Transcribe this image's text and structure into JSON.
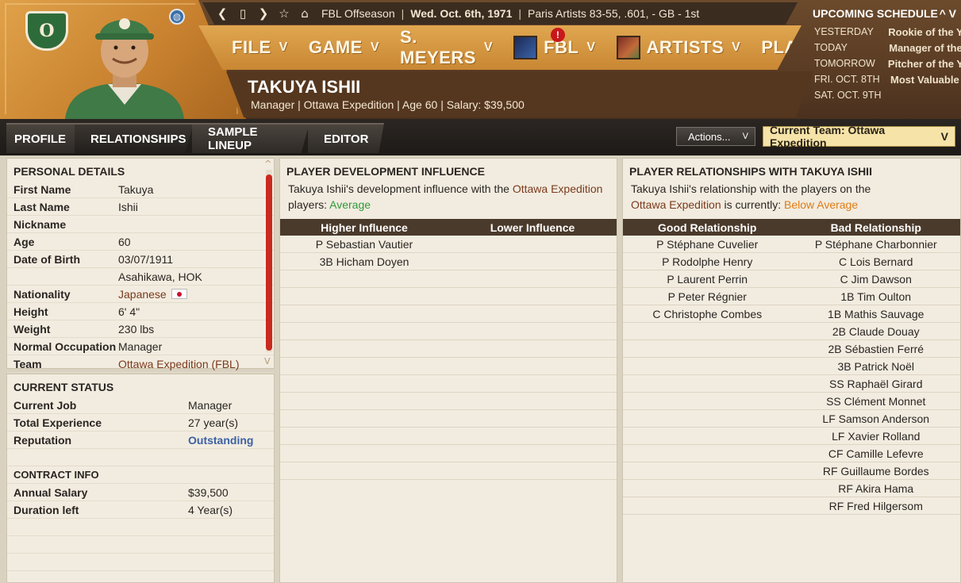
{
  "topbar": {
    "back_icon": "chevron-left-icon",
    "page_icon": "page-icon",
    "forward_icon": "chevron-right-icon",
    "star_icon": "star-icon",
    "home_icon": "home-icon",
    "stage": "FBL Offseason",
    "date": "Wed. Oct. 6th, 1971",
    "team_record": "Paris Artists  83-55, .601, - GB - 1st"
  },
  "menu": {
    "file": "FILE",
    "game": "GAME",
    "manager": "S. MEYERS",
    "league": "FBL",
    "league_alert": "!",
    "team": "ARTISTS",
    "play": "PLAY",
    "chevron": "V"
  },
  "person": {
    "name": "TAKUYA ISHII",
    "subtitle": "Manager | Ottawa Expedition  |  Age 60  |  Salary: $39,500",
    "team_logo_letter": "O"
  },
  "schedule": {
    "title": "UPCOMING SCHEDULE",
    "arrows": "^ V",
    "rows": [
      {
        "day": "YESTERDAY",
        "event": "Rookie of the Y"
      },
      {
        "day": "TODAY",
        "event": "Manager of the"
      },
      {
        "day": "TOMORROW",
        "event": "Pitcher of the Y"
      },
      {
        "day": "FRI. OCT. 8TH",
        "event": "Most Valuable"
      },
      {
        "day": "SAT. OCT. 9TH",
        "event": ""
      }
    ]
  },
  "tabs": {
    "profile": "PROFILE",
    "relationships": "RELATIONSHIPS",
    "sample_lineup": "SAMPLE LINEUP",
    "editor": "EDITOR"
  },
  "actions": {
    "label": "Actions...",
    "chevron": "V"
  },
  "team_select": {
    "label": "Current Team: Ottawa Expedition",
    "chevron": "V"
  },
  "personal": {
    "title": "PERSONAL DETAILS",
    "first_name_label": "First Name",
    "first_name": "Takuya",
    "last_name_label": "Last Name",
    "last_name": "Ishii",
    "nickname_label": "Nickname",
    "nickname": "",
    "age_label": "Age",
    "age": "60",
    "dob_label": "Date of Birth",
    "dob": "03/07/1911",
    "birthplace": "Asahikawa, HOK",
    "nationality_label": "Nationality",
    "nationality": "Japanese",
    "height_label": "Height",
    "height": "6' 4\"",
    "weight_label": "Weight",
    "weight": "230 lbs",
    "occupation_label": "Normal Occupation",
    "occupation": "Manager",
    "team_label": "Team",
    "team": "Ottawa Expedition (FBL)",
    "scroll_up": "^",
    "scroll_down": "V"
  },
  "status": {
    "title": "CURRENT STATUS",
    "job_label": "Current Job",
    "job": "Manager",
    "experience_label": "Total Experience",
    "experience": "27 year(s)",
    "reputation_label": "Reputation",
    "reputation": "Outstanding"
  },
  "contract": {
    "title": "CONTRACT INFO",
    "salary_label": "Annual Salary",
    "salary": "$39,500",
    "duration_label": "Duration left",
    "duration": "4 Year(s)"
  },
  "development": {
    "title": "PLAYER DEVELOPMENT INFLUENCE",
    "intro_a": "Takuya Ishii's development influence with the ",
    "intro_team": "Ottawa Expedition",
    "intro_b": "players: ",
    "rating": "Average",
    "col_high": "Higher Influence",
    "col_low": "Lower Influence",
    "rows": [
      {
        "high": "P Sebastian  Vautier",
        "low": ""
      },
      {
        "high": "3B Hicham Doyen",
        "low": ""
      }
    ]
  },
  "relationships": {
    "title": "PLAYER RELATIONSHIPS WITH TAKUYA ISHII",
    "intro_a": "Takuya Ishii's relationship with the players on the",
    "intro_team": "Ottawa Expedition",
    "intro_b": " is currently: ",
    "rating": "Below Average",
    "col_good": "Good Relationship",
    "col_bad": "Bad Relationship",
    "rows": [
      {
        "good": "P Stéphane Cuvelier",
        "bad": "P Stéphane Charbonnier"
      },
      {
        "good": "P Rodolphe Henry",
        "bad": "C Lois Bernard"
      },
      {
        "good": "P Laurent Perrin",
        "bad": "C Jim Dawson"
      },
      {
        "good": "P Peter Régnier",
        "bad": "1B Tim Oulton"
      },
      {
        "good": "C Christophe Combes",
        "bad": "1B Mathis Sauvage"
      },
      {
        "good": "",
        "bad": "2B Claude Douay"
      },
      {
        "good": "",
        "bad": "2B Sébastien Ferré"
      },
      {
        "good": "",
        "bad": "3B Patrick Noël"
      },
      {
        "good": "",
        "bad": "SS Raphaël Girard"
      },
      {
        "good": "",
        "bad": "SS Clément Monnet"
      },
      {
        "good": "",
        "bad": "LF Samson Anderson"
      },
      {
        "good": "",
        "bad": "LF Xavier Rolland"
      },
      {
        "good": "",
        "bad": "CF Camille Lefevre"
      },
      {
        "good": "",
        "bad": "RF Guillaume Bordes"
      },
      {
        "good": "",
        "bad": "RF Akira Hama"
      },
      {
        "good": "",
        "bad": "RF Fred Hilgersom"
      }
    ]
  }
}
